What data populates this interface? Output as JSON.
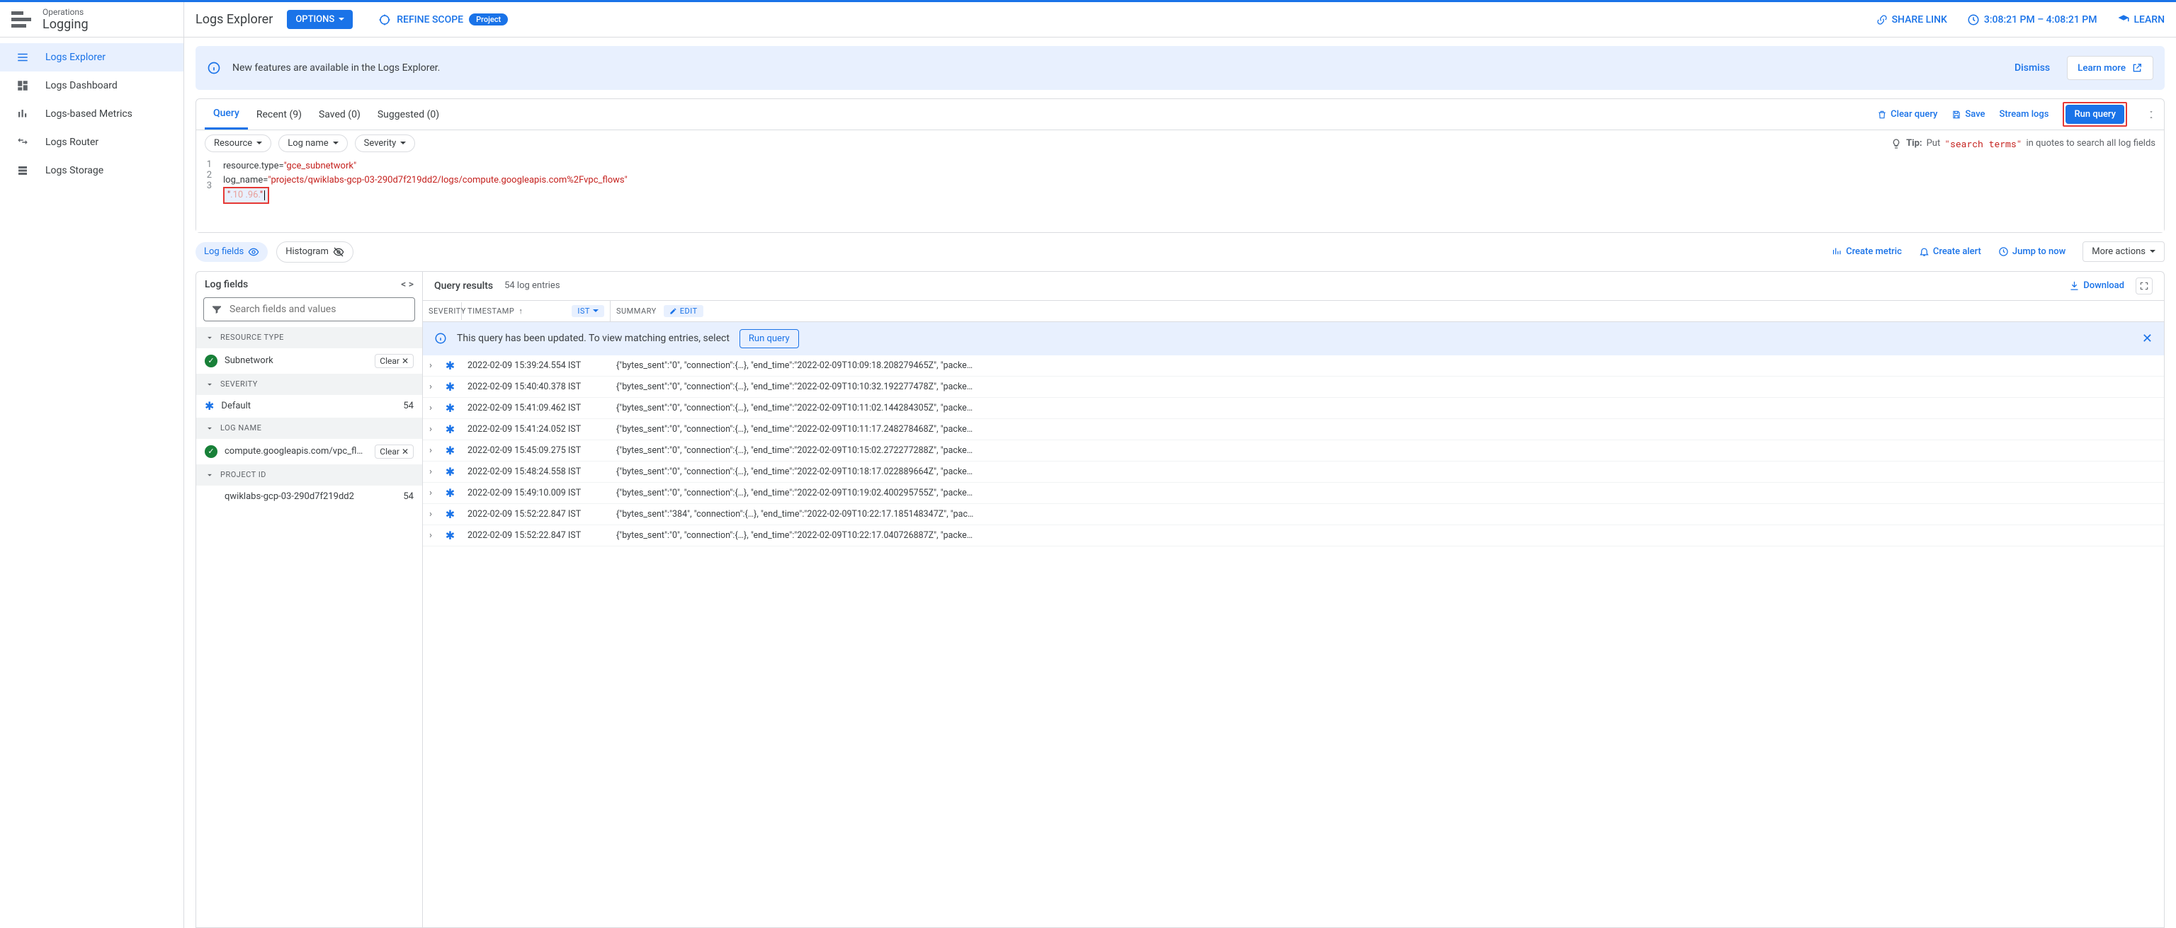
{
  "sidebar": {
    "overline": "Operations",
    "title": "Logging",
    "items": [
      {
        "label": "Logs Explorer",
        "active": true
      },
      {
        "label": "Logs Dashboard"
      },
      {
        "label": "Logs-based Metrics"
      },
      {
        "label": "Logs Router"
      },
      {
        "label": "Logs Storage"
      }
    ]
  },
  "header": {
    "page_title": "Logs Explorer",
    "options": "OPTIONS",
    "refine": "REFINE SCOPE",
    "scope_chip": "Project",
    "share": "SHARE LINK",
    "time": "3:08:21 PM – 4:08:21 PM",
    "learn": "LEARN"
  },
  "banner": {
    "text": "New features are available in the Logs Explorer.",
    "dismiss": "Dismiss",
    "learn_more": "Learn more"
  },
  "tabs": {
    "items": [
      {
        "label": "Query",
        "active": true
      },
      {
        "label": "Recent (9)"
      },
      {
        "label": "Saved (0)"
      },
      {
        "label": "Suggested (0)"
      }
    ],
    "clear": "Clear query",
    "save": "Save",
    "stream": "Stream logs",
    "run": "Run query"
  },
  "filters": {
    "resource": "Resource",
    "logname": "Log name",
    "severity": "Severity",
    "tip_label": "Tip:",
    "tip_prefix": "Put",
    "tip_quote": "\"search terms\"",
    "tip_suffix": "in quotes to search all log fields"
  },
  "editor": {
    "lines": [
      "1",
      "2",
      "3"
    ],
    "line1_a": "resource.type=",
    "line1_b": "\"gce_subnetwork\"",
    "line2_a": "log_name=",
    "line2_b": "\"projects/qwiklabs-gcp-03-290d7f219dd2/logs/compute.googleapis.com%2Fvpc_flows\"",
    "line3_q1": "\"",
    "line3_v": ".10 .96.",
    "line3_q2": "\""
  },
  "chips": {
    "log_fields": "Log fields",
    "histogram": "Histogram",
    "create_metric": "Create metric",
    "create_alert": "Create alert",
    "jump_now": "Jump to now",
    "more": "More actions"
  },
  "fields": {
    "title": "Log fields",
    "search_ph": "Search fields and values",
    "groups": [
      {
        "name": "RESOURCE TYPE",
        "items": [
          {
            "kind": "check",
            "label": "Subnetwork",
            "clear": true
          }
        ]
      },
      {
        "name": "SEVERITY",
        "items": [
          {
            "kind": "ast",
            "label": "Default",
            "count": "54"
          }
        ]
      },
      {
        "name": "LOG NAME",
        "items": [
          {
            "kind": "check",
            "label": "compute.googleapis.com/vpc_fl…",
            "clear": true
          }
        ]
      },
      {
        "name": "PROJECT ID",
        "items": [
          {
            "kind": "plain",
            "label": "qwiklabs-gcp-03-290d7f219dd2",
            "count": "54"
          }
        ]
      }
    ],
    "clear": "Clear"
  },
  "results": {
    "title": "Query results",
    "count": "54 log entries",
    "download": "Download",
    "cols": {
      "sev": "SEVERITY",
      "ts": "TIMESTAMP",
      "ist": "IST",
      "sum": "SUMMARY",
      "edit": "EDIT"
    },
    "notice": "This query has been updated. To view matching entries, select",
    "notice_btn": "Run query",
    "rows": [
      {
        "ts": "2022-02-09 15:39:24.554 IST",
        "sum": "{\"bytes_sent\":\"0\", \"connection\":{…}, \"end_time\":\"2022-02-09T10:09:18.208279465Z\", \"packe…"
      },
      {
        "ts": "2022-02-09 15:40:40.378 IST",
        "sum": "{\"bytes_sent\":\"0\", \"connection\":{…}, \"end_time\":\"2022-02-09T10:10:32.192277478Z\", \"packe…"
      },
      {
        "ts": "2022-02-09 15:41:09.462 IST",
        "sum": "{\"bytes_sent\":\"0\", \"connection\":{…}, \"end_time\":\"2022-02-09T10:11:02.144284305Z\", \"packe…"
      },
      {
        "ts": "2022-02-09 15:41:24.052 IST",
        "sum": "{\"bytes_sent\":\"0\", \"connection\":{…}, \"end_time\":\"2022-02-09T10:11:17.248278468Z\", \"packe…"
      },
      {
        "ts": "2022-02-09 15:45:09.275 IST",
        "sum": "{\"bytes_sent\":\"0\", \"connection\":{…}, \"end_time\":\"2022-02-09T10:15:02.272277288Z\", \"packe…"
      },
      {
        "ts": "2022-02-09 15:48:24.558 IST",
        "sum": "{\"bytes_sent\":\"0\", \"connection\":{…}, \"end_time\":\"2022-02-09T10:18:17.022889664Z\", \"packe…"
      },
      {
        "ts": "2022-02-09 15:49:10.009 IST",
        "sum": "{\"bytes_sent\":\"0\", \"connection\":{…}, \"end_time\":\"2022-02-09T10:19:02.400295755Z\", \"packe…"
      },
      {
        "ts": "2022-02-09 15:52:22.847 IST",
        "sum": "{\"bytes_sent\":\"384\", \"connection\":{…}, \"end_time\":\"2022-02-09T10:22:17.185148347Z\", \"pac…"
      },
      {
        "ts": "2022-02-09 15:52:22.847 IST",
        "sum": "{\"bytes_sent\":\"0\", \"connection\":{…}, \"end_time\":\"2022-02-09T10:22:17.040726887Z\", \"packe…"
      }
    ]
  }
}
